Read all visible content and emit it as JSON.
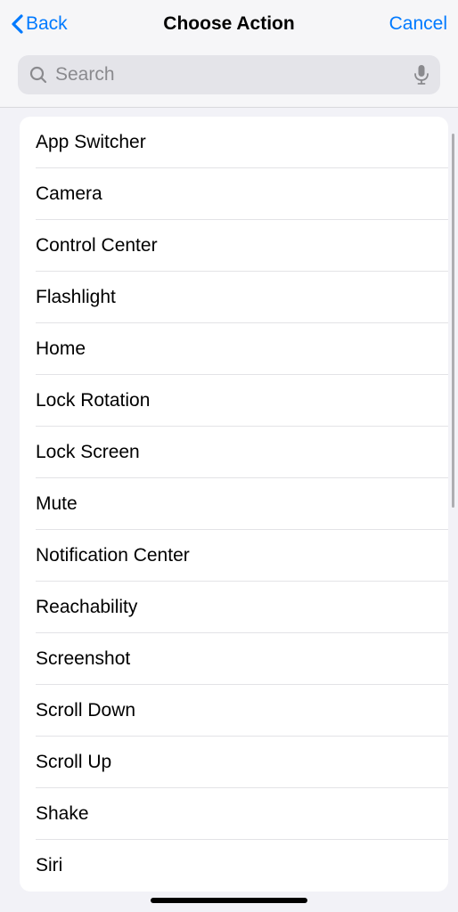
{
  "nav": {
    "back_label": "Back",
    "title": "Choose Action",
    "cancel_label": "Cancel"
  },
  "search": {
    "placeholder": "Search"
  },
  "actions": [
    "App Switcher",
    "Camera",
    "Control Center",
    "Flashlight",
    "Home",
    "Lock Rotation",
    "Lock Screen",
    "Mute",
    "Notification Center",
    "Reachability",
    "Screenshot",
    "Scroll Down",
    "Scroll Up",
    "Shake",
    "Siri"
  ]
}
